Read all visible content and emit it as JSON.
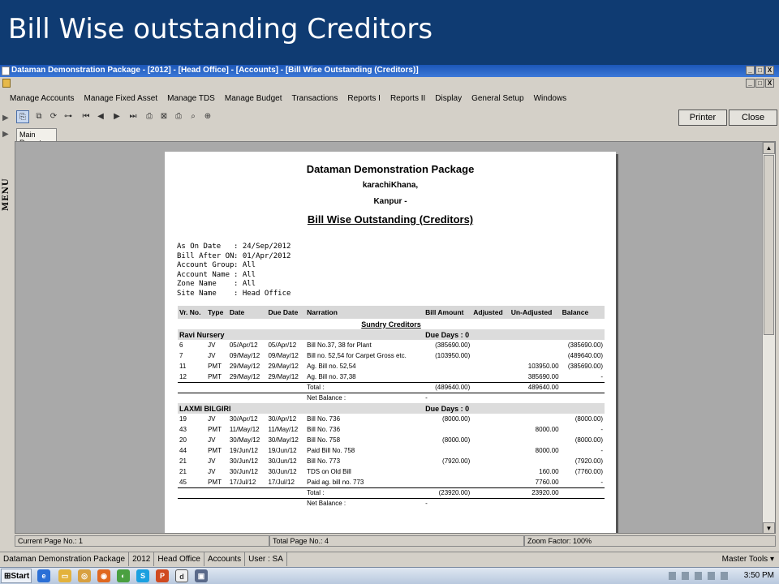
{
  "slide": {
    "title": "Bill Wise outstanding Creditors"
  },
  "window": {
    "title": "Dataman Demonstration Package - [2012] - [Head Office] - [Accounts] - [Bill Wise Outstanding (Creditors)]",
    "controls": [
      "_",
      "□",
      "X"
    ]
  },
  "menu": [
    "Manage Accounts",
    "Manage Fixed Asset",
    "Manage TDS",
    "Manage Budget",
    "Transactions",
    "Reports I",
    "Reports II",
    "Display",
    "General Setup",
    "Windows"
  ],
  "side_menu_label": "MENU",
  "toolbar": {
    "printer": "Printer",
    "close": "Close"
  },
  "tab": "Main Report",
  "report": {
    "company": "Dataman Demonstration Package",
    "address1": "karachiKhana,",
    "address2": "Kanpur -",
    "title": "Bill Wise Outstanding (Creditors)",
    "params": [
      {
        "label": "As On Date",
        "value": ": 24/Sep/2012"
      },
      {
        "label": "Bill After ON",
        "value": ": 01/Apr/2012"
      },
      {
        "label": "Account Group",
        "value": ": All"
      },
      {
        "label": "Account Name",
        "value": ": All"
      },
      {
        "label": "Zone Name",
        "value": ": All"
      },
      {
        "label": "Site Name",
        "value": ": Head Office"
      }
    ],
    "columns": [
      "Vr. No.",
      "Type",
      "Date",
      "Due Date",
      "Narration",
      "Bill Amount",
      "Adjusted",
      "Un-Adjusted",
      "Balance"
    ],
    "section": "Sundry Creditors",
    "groups": [
      {
        "name": "Ravi Nursery",
        "due_days": "Due Days : 0",
        "rows": [
          [
            "6",
            "JV",
            "05/Apr/12",
            "05/Apr/12",
            "Bill No.37, 38 for Plant",
            "(385690.00)",
            "",
            "",
            "(385690.00)"
          ],
          [
            "7",
            "JV",
            "09/May/12",
            "09/May/12",
            "Bill no. 52,54 for Carpet Gross etc.",
            "(103950.00)",
            "",
            "",
            "(489640.00)"
          ],
          [
            "11",
            "PMT",
            "29/May/12",
            "29/May/12",
            "Ag. Bill no. 52,54",
            "",
            "",
            "103950.00",
            "(385690.00)"
          ],
          [
            "12",
            "PMT",
            "29/May/12",
            "29/May/12",
            "Ag. Bill no. 37,38",
            "",
            "",
            "385690.00",
            "-"
          ]
        ],
        "total_label": "Total :",
        "total_bill": "(489640.00)",
        "total_unadj": "489640.00",
        "net_label": "Net Balance :",
        "net_value": "-"
      },
      {
        "name": "LAXMI BILGIRI",
        "due_days": "Due Days : 0",
        "rows": [
          [
            "19",
            "JV",
            "30/Apr/12",
            "30/Apr/12",
            "Bill No. 736",
            "(8000.00)",
            "",
            "",
            "(8000.00)"
          ],
          [
            "43",
            "PMT",
            "11/May/12",
            "11/May/12",
            "Bill No. 736",
            "",
            "",
            "8000.00",
            "-"
          ],
          [
            "20",
            "JV",
            "30/May/12",
            "30/May/12",
            "Bill No. 758",
            "(8000.00)",
            "",
            "",
            "(8000.00)"
          ],
          [
            "44",
            "PMT",
            "19/Jun/12",
            "19/Jun/12",
            "Paid Bill No. 758",
            "",
            "",
            "8000.00",
            "-"
          ],
          [
            "21",
            "JV",
            "30/Jun/12",
            "30/Jun/12",
            "Bill No. 773",
            "(7920.00)",
            "",
            "",
            "(7920.00)"
          ],
          [
            "21",
            "JV",
            "30/Jun/12",
            "30/Jun/12",
            "TDS on Old Bill",
            "",
            "",
            "160.00",
            "(7760.00)"
          ],
          [
            "45",
            "PMT",
            "17/Jul/12",
            "17/Jul/12",
            "Paid ag. bill no. 773",
            "",
            "",
            "7760.00",
            "-"
          ]
        ],
        "total_label": "Total :",
        "total_bill": "(23920.00)",
        "total_unadj": "23920.00",
        "net_label": "Net Balance :",
        "net_value": "-"
      }
    ]
  },
  "pagebar": {
    "current": "Current Page No.: 1",
    "total": "Total Page No.: 4",
    "zoom": "Zoom Factor: 100%"
  },
  "status": [
    "Dataman Demonstration Package",
    "2012",
    "Head Office",
    "Accounts",
    "User : SA"
  ],
  "master_tools": "Master Tools",
  "taskbar": {
    "start": "Start",
    "clock": "3:50 PM"
  },
  "colors": {
    "slide_bg": "#0f3b72",
    "titlebar": "#1c57b8",
    "viewer_bg": "#a9a9a9"
  }
}
